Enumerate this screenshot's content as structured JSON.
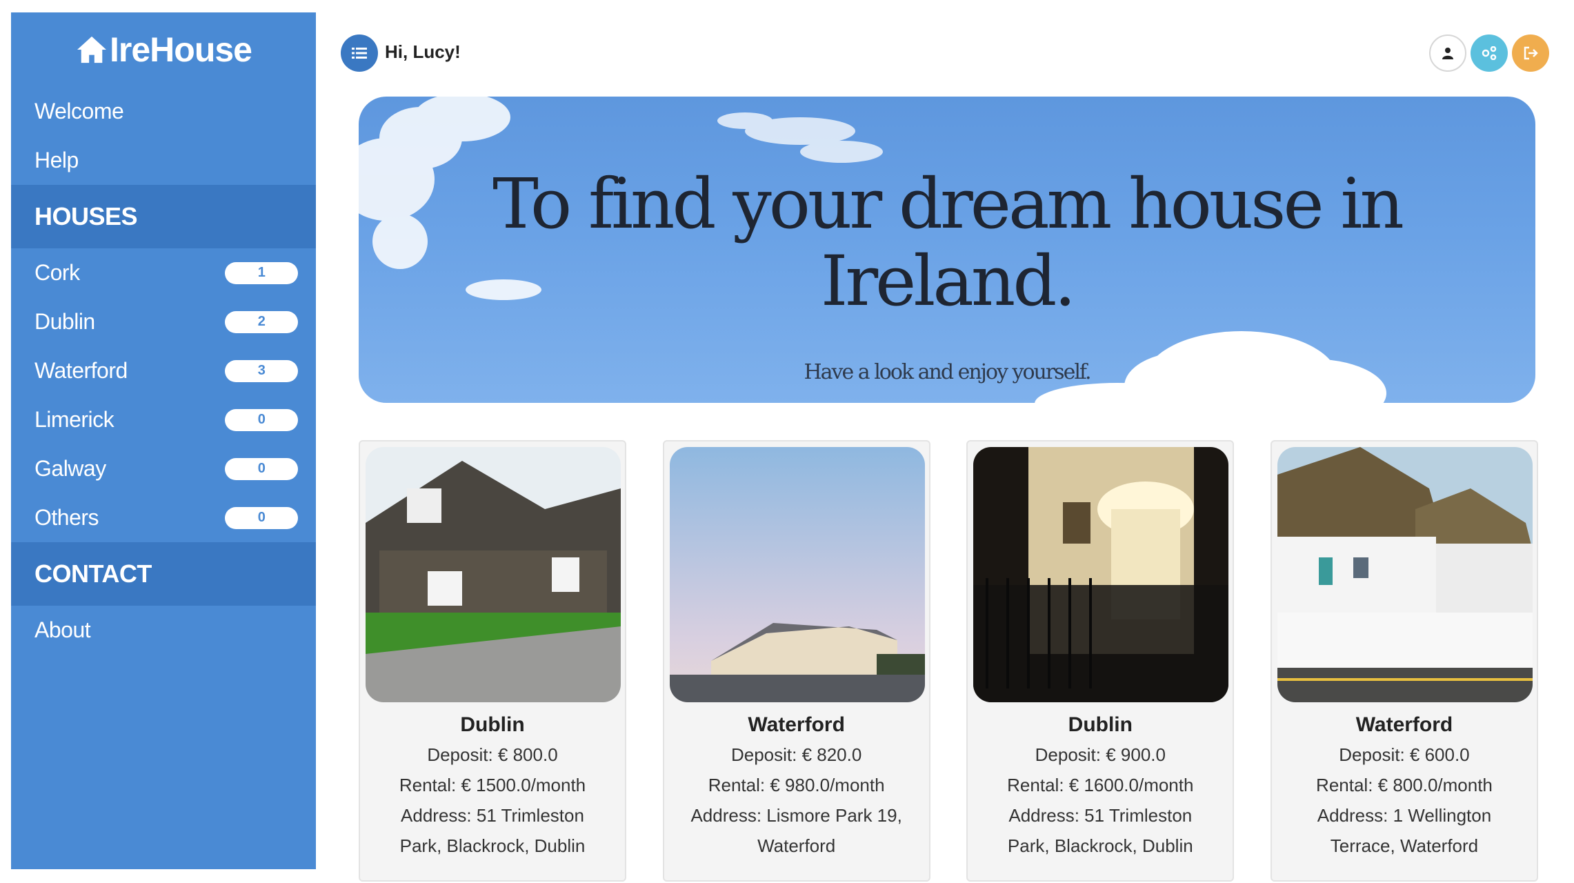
{
  "brand": {
    "name": "IreHouse",
    "icon": "home-icon"
  },
  "sidebar": {
    "top_links": [
      {
        "label": "Welcome"
      },
      {
        "label": "Help"
      }
    ],
    "houses_header": "HOUSES",
    "houses": [
      {
        "label": "Cork",
        "count": "1"
      },
      {
        "label": "Dublin",
        "count": "2"
      },
      {
        "label": "Waterford",
        "count": "3"
      },
      {
        "label": "Limerick",
        "count": "0"
      },
      {
        "label": "Galway",
        "count": "0"
      },
      {
        "label": "Others",
        "count": "0"
      }
    ],
    "contact_header": "CONTACT",
    "contact_links": [
      {
        "label": "About"
      }
    ]
  },
  "topbar": {
    "greeting": "Hi, Lucy!",
    "menu_icon": "list-icon",
    "icons": [
      "user-icon",
      "share-icon",
      "logout-icon"
    ]
  },
  "banner": {
    "title_line1": "To find your dream house in",
    "title_line2": "Ireland.",
    "subtitle": "Have a look and enjoy yourself."
  },
  "listings": [
    {
      "city": "Dublin",
      "deposit": "Deposit: € 800.0",
      "rental": "Rental: € 1500.0/month",
      "address_1": "Address: 51 Trimleston",
      "address_2": "Park, Blackrock, Dublin"
    },
    {
      "city": "Waterford",
      "deposit": "Deposit: € 820.0",
      "rental": "Rental: € 980.0/month",
      "address_1": "Address: Lismore Park 19,",
      "address_2": "Waterford"
    },
    {
      "city": "Dublin",
      "deposit": "Deposit: € 900.0",
      "rental": "Rental: € 1600.0/month",
      "address_1": "Address: 51 Trimleston",
      "address_2": "Park, Blackrock, Dublin"
    },
    {
      "city": "Waterford",
      "deposit": "Deposit: € 600.0",
      "rental": "Rental: € 800.0/month",
      "address_1": "Address: 1 Wellington",
      "address_2": "Terrace, Waterford"
    }
  ],
  "colors": {
    "sidebar": "#4a8ad4",
    "section_header": "#3a78c2",
    "share": "#5bc0de",
    "logout": "#f0ad4e"
  }
}
